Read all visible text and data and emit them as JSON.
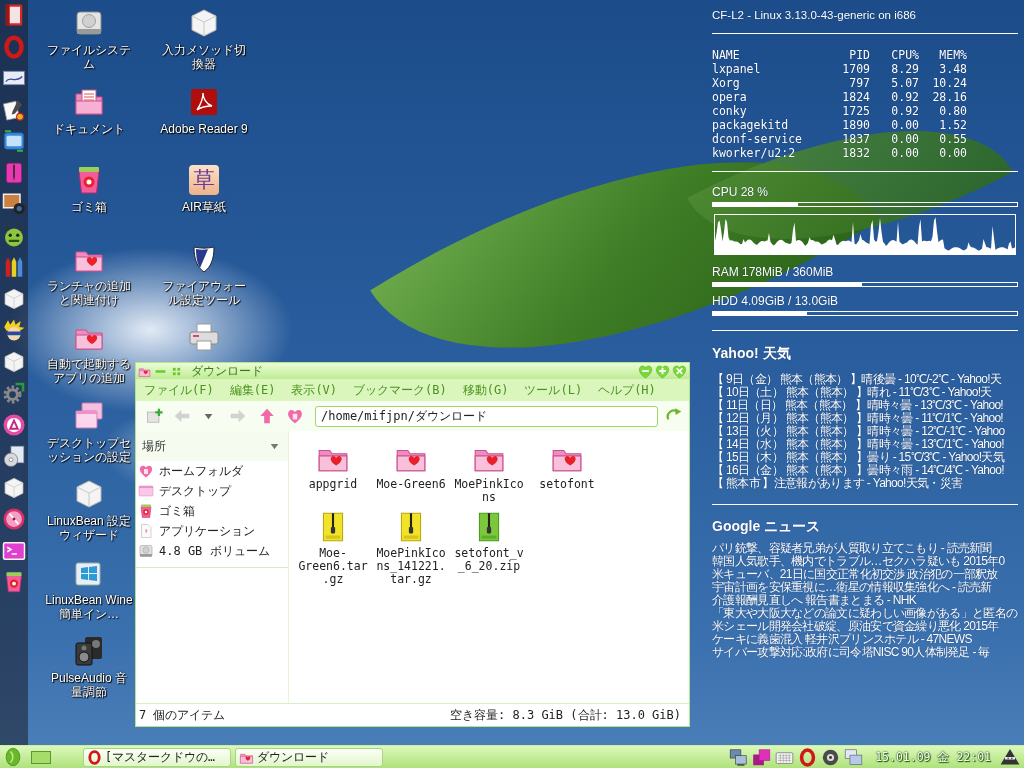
{
  "desktop_icons": [
    {
      "kind": "drive",
      "label": "ファイルシステム"
    },
    {
      "kind": "document-folder",
      "label": "ドキュメント"
    },
    {
      "kind": "trash",
      "label": "ゴミ箱"
    },
    {
      "kind": "heart-folder",
      "label": "ランチャの追加と関連付け"
    },
    {
      "kind": "heart-folder",
      "label": "自動で起動するアプリの追加"
    },
    {
      "kind": "windows",
      "label": "デスクトップセッションの設定"
    },
    {
      "kind": "cube",
      "label": "LinuxBean 設定ウィザード"
    },
    {
      "kind": "panes",
      "label": "LinuxBean Wine 簡単イン…"
    },
    {
      "kind": "speakers",
      "label": "PulseAudio 音量調節"
    },
    {
      "kind": "cube",
      "label": "入力メソッド切換器"
    },
    {
      "kind": "swoosh",
      "label": "Adobe Reader 9"
    },
    {
      "kind": "glyph-tile",
      "glyph": "草",
      "label": "AIR草紙"
    },
    {
      "kind": "shield",
      "label": "ファイアウォール設定ツール"
    },
    {
      "kind": "printer"
    }
  ],
  "conky": {
    "system": "CF-L2 - Linux 3.13.0-43-generic on i686",
    "processes": {
      "columns": [
        "NAME",
        "PID",
        "CPU%",
        "MEM%"
      ],
      "rows": [
        [
          "lxpanel",
          "1709",
          "8.29",
          "3.48"
        ],
        [
          "Xorg",
          "797",
          "5.07",
          "10.24"
        ],
        [
          "opera",
          "1824",
          "0.92",
          "28.16"
        ],
        [
          "conky",
          "1725",
          "0.92",
          "0.80"
        ],
        [
          "packagekitd",
          "1890",
          "0.00",
          "1.52"
        ],
        [
          "dconf-service",
          "1837",
          "0.00",
          "0.55"
        ],
        [
          "kworker/u2:2",
          "1832",
          "0.00",
          "0.00"
        ]
      ]
    },
    "cpu": {
      "label": "CPU 28 %",
      "level": 0.28
    },
    "ram": {
      "label": "RAM 178MiB / 360MiB",
      "level": 0.49
    },
    "hdd": {
      "label": "HDD 4.09GiB / 13.0GiB",
      "level": 0.31
    },
    "weather": {
      "title": "Yahoo! 天気",
      "lines": [
        "【 9日（金） 熊本（熊本） 】晴後曇 - 10℃/-2℃ - Yahoo!天",
        "【 10日（土） 熊本（熊本） 】晴れ - 11℃/3℃ - Yahoo!天",
        "【 11日（日） 熊本（熊本） 】晴時々曇 - 13℃/3℃ - Yahoo!",
        "【 12日（月） 熊本（熊本） 】晴時々曇 - 11℃/1℃ - Yahoo!",
        "【 13日（火） 熊本（熊本） 】晴時々曇 - 12℃/-1℃ - Yahoo",
        "【 14日（水） 熊本（熊本） 】晴時々曇 - 13℃/1℃ - Yahoo!",
        "【 15日（木） 熊本（熊本） 】曇り - 15℃/3℃ - Yahoo!天気",
        "【 16日（金） 熊本（熊本） 】曇時々雨 - 14℃/4℃ - Yahoo!",
        "【 熊本市 】注意報があります - Yahoo!天気・災害"
      ]
    },
    "news": {
      "title": "Google ニュース",
      "lines": [
        "パリ銃撃、容疑者兄弟が人質取り立てこもり - 読売新聞",
        "韓国人気歌手、機内でトラブル…セクハラ疑いも 2015年0",
        "米キューバ、21日に国交正常化初交渉 政治犯の一部釈放",
        "宇宙計画を安保重視に…衛星の情報収集強化へ - 読売新",
        "介護報酬見直しへ 報告書まとまる - NHK",
        "「東大や大阪大などの論文に疑わしい画像がある」と匿名の",
        "米シェール開発会社破綻、原油安で資金繰り悪化 2015年",
        "ケーキに義歯混入 軽井沢プリンスホテル - 47NEWS",
        "サイバー攻撃対応:政府に司令塔NISC 90人体制発足 - 毎"
      ]
    }
  },
  "file_manager": {
    "title": "ダウンロード",
    "menu": [
      "ファイル(F)",
      "編集(E)",
      "表示(V)",
      "ブックマーク(B)",
      "移動(G)",
      "ツール(L)",
      "ヘルプ(H)"
    ],
    "toolbar": [
      {
        "kind": "new-tab",
        "disabled": false
      },
      {
        "kind": "back",
        "disabled": true
      },
      {
        "kind": "history",
        "disabled": false
      },
      {
        "kind": "forward",
        "disabled": true
      },
      {
        "kind": "up",
        "disabled": false
      },
      {
        "kind": "home",
        "disabled": false
      }
    ],
    "path": "/home/mifjpn/ダウンロード",
    "places_header": "場所",
    "places": [
      {
        "kind": "home",
        "label": "ホームフォルダ",
        "selected": false
      },
      {
        "kind": "desktop",
        "label": "デスクトップ",
        "selected": false
      },
      {
        "kind": "trash",
        "label": "ゴミ箱",
        "selected": false
      },
      {
        "kind": "applications",
        "label": "アプリケーション",
        "selected": false
      },
      {
        "kind": "volume",
        "label": "4.8 GB ボリューム",
        "selected": false
      }
    ],
    "files": [
      {
        "kind": "folder",
        "name": "appgrid",
        "selected": false
      },
      {
        "kind": "folder",
        "name": "Moe-Green6",
        "selected": false
      },
      {
        "kind": "folder",
        "name": "MoePinkIcons",
        "selected": false
      },
      {
        "kind": "folder",
        "name": "setofont",
        "selected": false
      },
      {
        "kind": "tarball",
        "name": "Moe-Green6.tar.gz",
        "selected": false
      },
      {
        "kind": "tarball",
        "name": "MoePinkIcons_141221.tar.gz",
        "selected": false
      },
      {
        "kind": "zip",
        "name": "setofont_v_6_20.zip",
        "selected": false
      }
    ],
    "status_left": "7 個のアイテム",
    "status_right": "空き容量: 8.3 GiB (合計: 13.0 GiB)"
  },
  "taskbar": {
    "tasks": [
      {
        "kind": "browser",
        "label": "[マスタークドウの…"
      },
      {
        "kind": "folder",
        "label": "ダウンロード"
      }
    ],
    "clock": "15.01.09 金 22:01"
  }
}
